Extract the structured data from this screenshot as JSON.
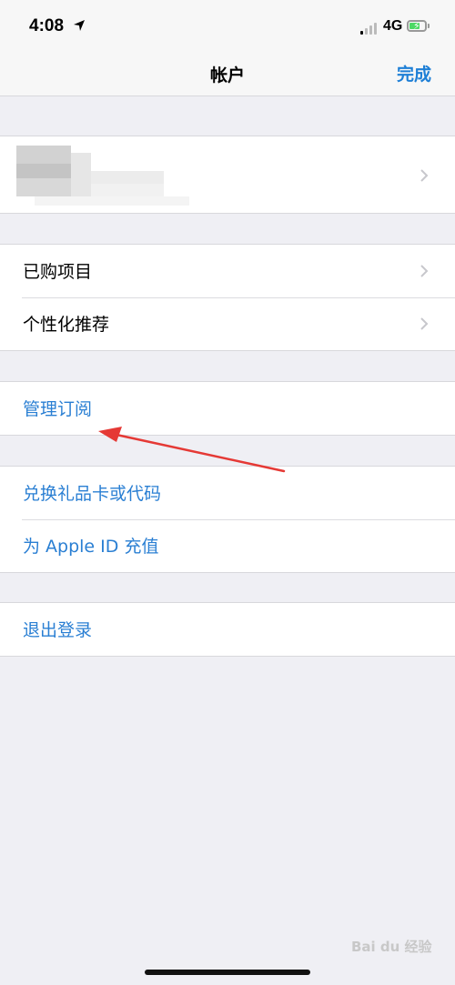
{
  "status_bar": {
    "time": "4:08",
    "network": "4G",
    "icons": [
      "location-arrow-icon",
      "signal-icon",
      "battery-charging-icon"
    ]
  },
  "nav": {
    "title": "帐户",
    "done_label": "完成"
  },
  "groups": {
    "purchases": [
      {
        "label": "已购项目"
      },
      {
        "label": "个性化推荐"
      }
    ],
    "subscriptions": [
      {
        "label": "管理订阅"
      }
    ],
    "gift": [
      {
        "label": "兑换礼品卡或代码"
      },
      {
        "label": "为 Apple ID 充值"
      }
    ],
    "signout": [
      {
        "label": "退出登录"
      }
    ]
  },
  "watermark": {
    "text": "Bai du 经验"
  },
  "colors": {
    "link": "#2a7fd3",
    "done": "#1e7fd6",
    "background": "#efeff4",
    "annotation_arrow": "#e53935"
  }
}
